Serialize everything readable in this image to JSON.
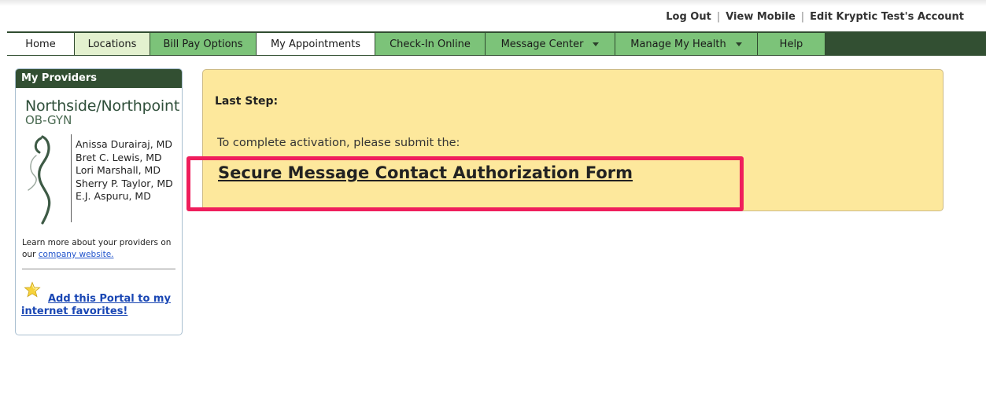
{
  "utility_links": {
    "logout": "Log Out",
    "view_mobile": "View Mobile",
    "edit_account": "Edit Kryptic Test's Account",
    "separator": "|"
  },
  "nav": {
    "tabs": [
      {
        "label": "Home"
      },
      {
        "label": "Locations"
      },
      {
        "label": "Bill Pay Options"
      },
      {
        "label": "My Appointments"
      },
      {
        "label": "Check-In Online"
      },
      {
        "label": "Message Center",
        "has_dropdown": true
      },
      {
        "label": "Manage My Health",
        "has_dropdown": true
      },
      {
        "label": "Help"
      }
    ]
  },
  "sidebar": {
    "heading": "My Providers",
    "brand_name": "Northside/Northpoint",
    "brand_subtitle": "OB-GYN",
    "providers": [
      "Anissa Durairaj, MD",
      "Bret C. Lewis, MD",
      "Lori Marshall, MD",
      "Sherry P. Taylor, MD",
      "E.J. Aspuru, MD"
    ],
    "learn_text": "Learn more about your providers on our",
    "learn_link": "company website.",
    "favorites_link": "Add this Portal to my internet favorites!",
    "favorites_icon": "star-icon"
  },
  "main": {
    "heading": "Last Step:",
    "instruction": "To complete activation, please submit the:",
    "form_link": "Secure Message Contact Authorization Form"
  },
  "colors": {
    "nav_dark": "#324f32",
    "tab_green": "#7cc379",
    "tab_pale": "#e3f1cf",
    "panel_bg": "#fde89c",
    "highlight": "#ef1e5c",
    "link_blue": "#1a47b4"
  }
}
